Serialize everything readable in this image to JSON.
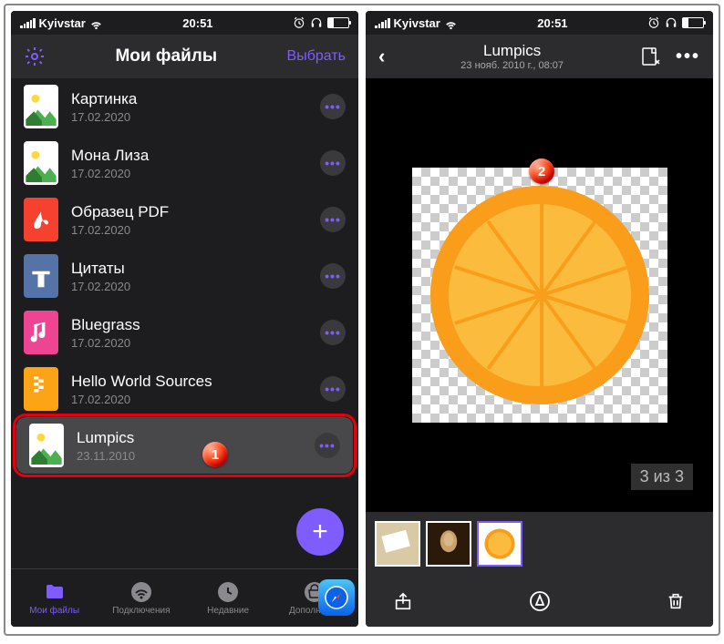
{
  "status": {
    "carrier": "Kyivstar",
    "time": "20:51"
  },
  "left": {
    "title": "Мои файлы",
    "select": "Выбрать",
    "files": [
      {
        "name": "Картинка",
        "date": "17.02.2020",
        "type": "img"
      },
      {
        "name": "Мона Лиза",
        "date": "17.02.2020",
        "type": "img"
      },
      {
        "name": "Образец PDF",
        "date": "17.02.2020",
        "type": "pdf"
      },
      {
        "name": "Цитаты",
        "date": "17.02.2020",
        "type": "txt"
      },
      {
        "name": "Bluegrass",
        "date": "17.02.2020",
        "type": "aud"
      },
      {
        "name": "Hello World Sources",
        "date": "17.02.2020",
        "type": "zip"
      },
      {
        "name": "Lumpics",
        "date": "23.11.2010",
        "type": "img",
        "highlight": true
      }
    ],
    "tabs": [
      {
        "label": "Мои файлы",
        "icon": "folder",
        "active": true
      },
      {
        "label": "Подключения",
        "icon": "wifi"
      },
      {
        "label": "Недавние",
        "icon": "clock"
      },
      {
        "label": "Дополнения",
        "icon": "bag"
      }
    ]
  },
  "right": {
    "title": "Lumpics",
    "subtitle": "23 нояб. 2010 г., 08:07",
    "counter": "3 из 3"
  },
  "badges": {
    "one": "1",
    "two": "2"
  }
}
